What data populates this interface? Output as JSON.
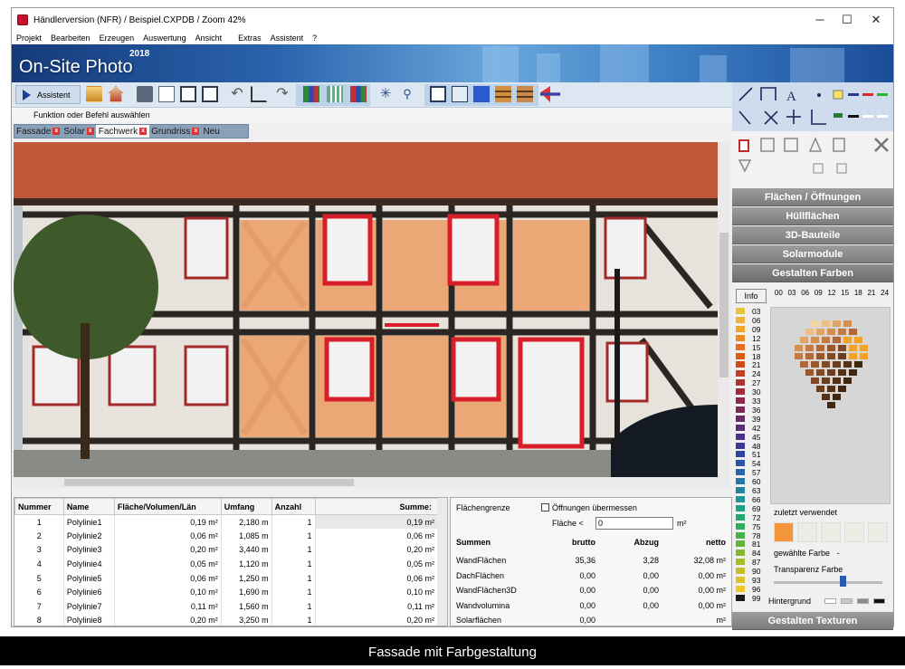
{
  "window": {
    "title": "Händlerversion (NFR) / Beispiel.CXPDB / Zoom 42%",
    "minimize": "─",
    "maximize": "☐",
    "close": "✕"
  },
  "menu": [
    "Projekt",
    "Bearbeiten",
    "Erzeugen",
    "Auswertung",
    "Ansicht",
    "Extras",
    "Assistent",
    "?"
  ],
  "banner": {
    "logo": "On-Site Photo",
    "year": "2018"
  },
  "toolbar": {
    "assistant_label": "Assistent"
  },
  "status": "Funktion oder Befehl auswählen",
  "tabs": [
    {
      "label": "Fassade"
    },
    {
      "label": "Solar"
    },
    {
      "label": "Fachwerk",
      "active": true
    },
    {
      "label": "Grundriss"
    },
    {
      "label": "Neu"
    }
  ],
  "table": {
    "columns": [
      "Nummer",
      "Name",
      "Fläche/Volumen/Län",
      "Umfang",
      "Anzahl",
      "Summe:"
    ],
    "rows": [
      [
        "1",
        "Polylinie1",
        "0,19 m²",
        "2,180 m",
        "1",
        "0,19 m²"
      ],
      [
        "2",
        "Polylinie2",
        "0,06 m²",
        "1,085 m",
        "1",
        "0,06 m²"
      ],
      [
        "3",
        "Polylinie3",
        "0,20 m²",
        "3,440 m",
        "1",
        "0,20 m²"
      ],
      [
        "4",
        "Polylinie4",
        "0,05 m²",
        "1,120 m",
        "1",
        "0,05 m²"
      ],
      [
        "5",
        "Polylinie5",
        "0,06 m²",
        "1,250 m",
        "1",
        "0,06 m²"
      ],
      [
        "6",
        "Polylinie6",
        "0,10 m²",
        "1,690 m",
        "1",
        "0,10 m²"
      ],
      [
        "7",
        "Polylinie7",
        "0,11 m²",
        "1,560 m",
        "1",
        "0,11 m²"
      ],
      [
        "8",
        "Polylinie8",
        "0,20 m²",
        "3,250 m",
        "1",
        "0,20 m²"
      ]
    ]
  },
  "summary": {
    "flaechengrenze_label": "Flächengrenze",
    "oeffnungen_label": "Öffnungen übermessen",
    "flaeche_label": "Fläche <",
    "flaeche_value": "0",
    "flaeche_unit": "m²",
    "headers": [
      "Summen",
      "brutto",
      "Abzug",
      "netto"
    ],
    "rows": [
      [
        "WandFlächen",
        "35,36",
        "3,28",
        "32,08 m²"
      ],
      [
        "DachFlächen",
        "0,00",
        "0,00",
        "0,00 m²"
      ],
      [
        "WandFlächen3D",
        "0,00",
        "0,00",
        "0,00 m²"
      ],
      [
        "Wandvolumina",
        "0,00",
        "0,00",
        "0,00 m²"
      ],
      [
        "Solarflächen",
        "0,00",
        "",
        "m²"
      ]
    ]
  },
  "right_panel": {
    "sections": [
      "Flächen / Öffnungen",
      "Hüllflächen",
      "3D-Bauteile",
      "Solarmodule",
      "Gestalten Farben"
    ],
    "info_button": "Info",
    "gray_values": [
      "00",
      "03",
      "06",
      "09",
      "12",
      "15",
      "18",
      "21",
      "24"
    ],
    "swatch_labels": [
      "03",
      "06",
      "09",
      "12",
      "15",
      "18",
      "21",
      "24",
      "27",
      "30",
      "33",
      "36",
      "39",
      "42",
      "45",
      "48",
      "51",
      "54",
      "57",
      "60",
      "63",
      "66",
      "69",
      "72",
      "75",
      "78",
      "81",
      "84",
      "87",
      "90",
      "93",
      "96",
      "99"
    ],
    "swatch_colors": [
      "#e8c43a",
      "#f0b23a",
      "#f5a52a",
      "#ef8a20",
      "#e66e1c",
      "#dc5a18",
      "#cf4a1a",
      "#c23e26",
      "#b03530",
      "#9e2c3a",
      "#8d2a48",
      "#7c2a58",
      "#6a2c68",
      "#5a2e78",
      "#4a3288",
      "#3c3a94",
      "#30469e",
      "#2a56a6",
      "#2666a8",
      "#2476a6",
      "#2286a0",
      "#209696",
      "#1ea286",
      "#22a872",
      "#30ac5c",
      "#48b04a",
      "#66b43a",
      "#86b830",
      "#a6bc2a",
      "#c4c026",
      "#dcc424",
      "#eec824",
      "#1a1a1a"
    ],
    "last_used_label": "zuletzt verwendet",
    "last_used_colors": [
      "#f4963a",
      "#ecebe4",
      "#ecebe4",
      "#ecebe4",
      "#ecebe4"
    ],
    "selected_color_label": "gewählte Farbe",
    "selected_color_value": "-",
    "transparency_label": "Transparenz Farbe",
    "transparency_value": 0.62,
    "background_label": "Hintergrund",
    "textures_button": "Gestalten Texturen"
  },
  "caption": "Fassade mit Farbgestaltung"
}
